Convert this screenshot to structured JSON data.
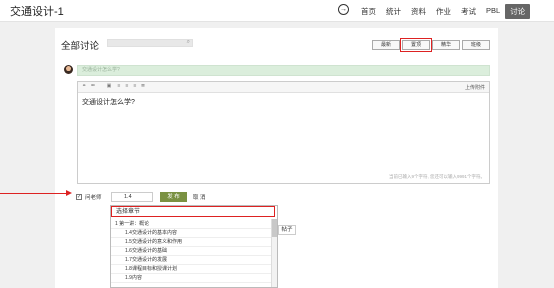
{
  "app": {
    "title": "交通设计-1"
  },
  "nav": {
    "arrow_glyph": "→",
    "items": [
      {
        "label": "首页",
        "active": false
      },
      {
        "label": "统计",
        "active": false
      },
      {
        "label": "资料",
        "active": false
      },
      {
        "label": "作业",
        "active": false
      },
      {
        "label": "考试",
        "active": false
      },
      {
        "label": "PBL",
        "active": false
      },
      {
        "label": "讨论",
        "active": true
      }
    ]
  },
  "page": {
    "title": "全部讨论",
    "search_icon": "⌕"
  },
  "sort_tabs": [
    {
      "label": "最新",
      "highlighted": false
    },
    {
      "label": "置顶",
      "highlighted": true
    },
    {
      "label": "精华",
      "highlighted": false
    },
    {
      "label": "班级",
      "highlighted": false
    }
  ],
  "question": {
    "placeholder": "交通设计怎么学?"
  },
  "editor": {
    "toolbar_icons": [
      "link-icon",
      "unlink-icon",
      "image-icon",
      "align-left-icon",
      "align-center-icon",
      "align-right-icon",
      "align-justify-icon"
    ],
    "toolbar_glyphs": [
      "⚭",
      "⚮",
      "▣",
      "≡",
      "≡",
      "≡",
      "≣"
    ],
    "upload_label": "上传附件",
    "content": "交通设计怎么学?",
    "counter": "当前已输入9个字符, 您还可以输入9991个字符。"
  },
  "footer": {
    "checkbox_checked": true,
    "checkbox_glyph": "✓",
    "ask_teacher_label": "问老师",
    "section_value": "1.4",
    "publish_label": "发 布",
    "cancel_label": "取 消",
    "side_button_label": "帖子"
  },
  "chapter_dropdown": {
    "header": "选择章节",
    "items": [
      {
        "label": "1 第一讲：概论",
        "level": "chapter"
      },
      {
        "label": "1.4交通设计的基本内容",
        "level": "section"
      },
      {
        "label": "1.5交通设计的意义和作用",
        "level": "section"
      },
      {
        "label": "1.6交通设计的基础",
        "level": "section"
      },
      {
        "label": "1.7交通设计的发展",
        "level": "section"
      },
      {
        "label": "1.8课程目标和授课计划",
        "level": "section"
      },
      {
        "label": "1.9内容",
        "level": "section"
      }
    ]
  }
}
